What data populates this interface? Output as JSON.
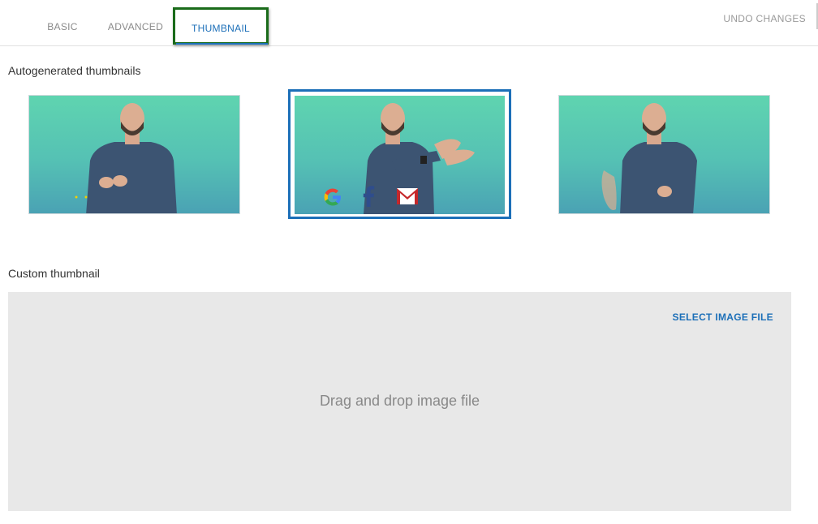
{
  "tabs": {
    "basic": "BASIC",
    "advanced": "ADVANCED",
    "thumbnail": "THUMBNAIL",
    "active": "THUMBNAIL"
  },
  "header": {
    "undo_label": "UNDO CHANGES"
  },
  "autogenerated": {
    "title": "Autogenerated thumbnails",
    "thumbnails": [
      {
        "selected": false
      },
      {
        "selected": true,
        "overlay_icons": [
          "google-icon",
          "facebook-icon",
          "gmail-icon"
        ]
      },
      {
        "selected": false
      }
    ]
  },
  "custom": {
    "title": "Custom thumbnail",
    "select_label": "SELECT IMAGE FILE",
    "drop_text": "Drag and drop image file"
  },
  "colors": {
    "accent": "#1c6fb8",
    "highlight_box": "#1a6b1a",
    "teal_background": "#5fd4b0",
    "dropzone_background": "#e8e8e8"
  }
}
